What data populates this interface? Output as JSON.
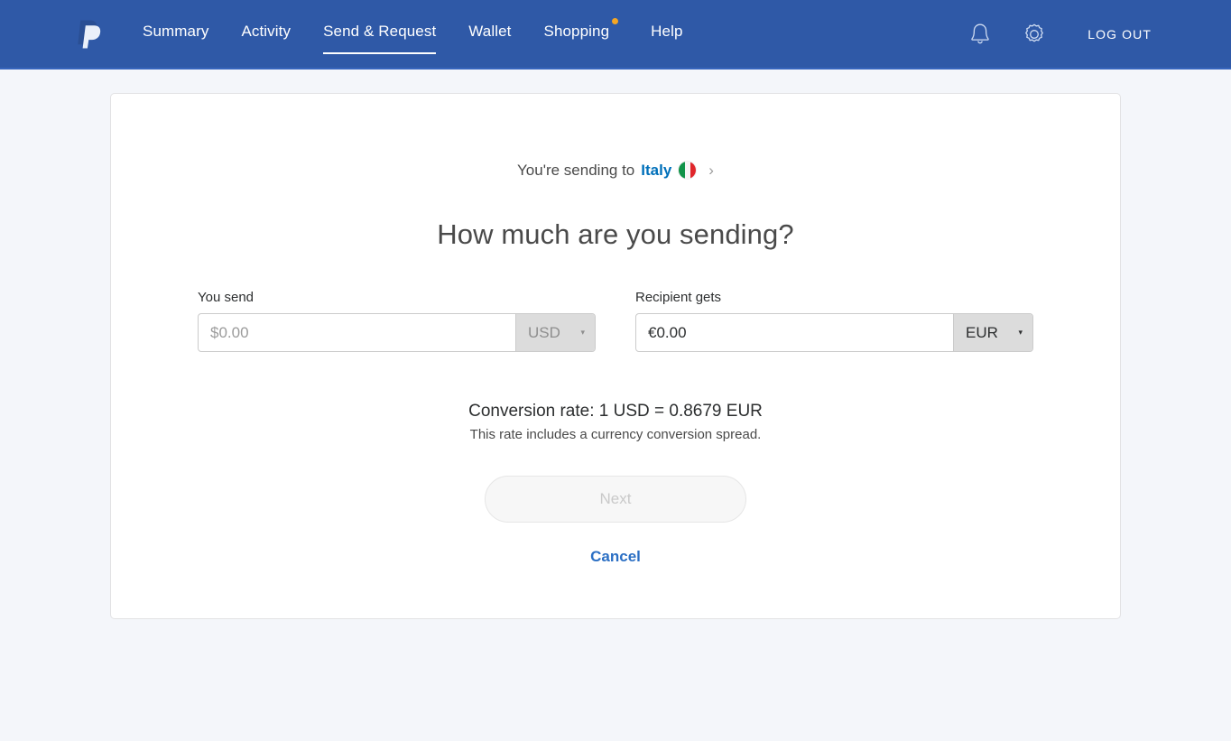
{
  "navbar": {
    "logo_name": "paypal-logo",
    "links": [
      {
        "label": "Summary",
        "active": false,
        "dot": false
      },
      {
        "label": "Activity",
        "active": false,
        "dot": false
      },
      {
        "label": "Send & Request",
        "active": true,
        "dot": false
      },
      {
        "label": "Wallet",
        "active": false,
        "dot": false
      },
      {
        "label": "Shopping",
        "active": false,
        "dot": true
      },
      {
        "label": "Help",
        "active": false,
        "dot": false
      }
    ],
    "notifications_icon": "bell-icon",
    "settings_icon": "gear-icon",
    "logout_label": "LOG OUT",
    "background_color": "#2f59a7",
    "dot_color": "#f5a623"
  },
  "card": {
    "sending_to_prefix": "You're sending to",
    "country": "Italy",
    "flag": "italy-flag",
    "chevron": "›",
    "headline": "How much are you sending?",
    "you_send": {
      "label": "You send",
      "value": "",
      "placeholder": "$0.00",
      "currency": "USD",
      "currency_disabled": true,
      "caret": "▾"
    },
    "recipient_gets": {
      "label": "Recipient gets",
      "value": "€0.00",
      "placeholder": "€0.00",
      "currency": "EUR",
      "currency_disabled": false,
      "caret": "▾"
    },
    "rate_line": "Conversion rate: 1 USD = 0.8679 EUR",
    "rate_note": "This rate includes a currency conversion spread.",
    "next_label": "Next",
    "next_disabled": true,
    "cancel_label": "Cancel",
    "link_color": "#2b6fc4",
    "country_color": "#0070ba"
  }
}
